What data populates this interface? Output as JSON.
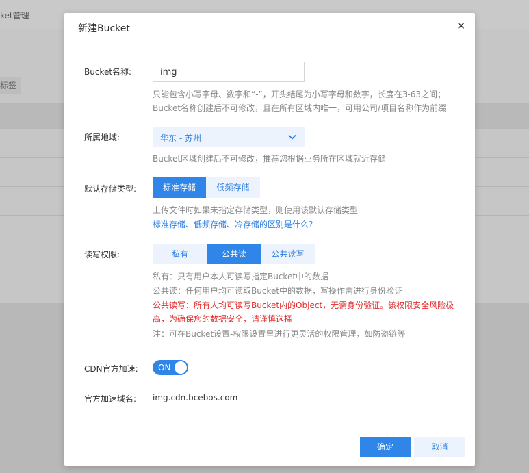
{
  "background": {
    "topbar_title": "ket管理",
    "tag_button": "标签"
  },
  "modal": {
    "title": "新建Bucket",
    "close_icon": "close-icon",
    "name": {
      "label": "Bucket名称:",
      "value": "img",
      "hint1": "只能包含小写字母、数字和“-”，开头结尾为小写字母和数字，长度在3-63之间；",
      "hint2": "Bucket名称创建后不可修改，且在所有区域内唯一，可用公司/项目名称作为前缀"
    },
    "region": {
      "label": "所属地域:",
      "value": "华东 - 苏州",
      "hint": "Bucket区域创建后不可修改，推荐您根据业务所在区域就近存储"
    },
    "storage": {
      "label": "默认存储类型:",
      "options": [
        "标准存储",
        "低频存储"
      ],
      "selected": "标准存储",
      "hint": "上传文件时如果未指定存储类型，则使用该默认存储类型",
      "link": "标准存储、低频存储、冷存储的区别是什么?"
    },
    "permission": {
      "label": "读写权限:",
      "options": [
        "私有",
        "公共读",
        "公共读写"
      ],
      "selected": "公共读",
      "desc_private": "私有：只有用户本人可读写指定Bucket中的数据",
      "desc_public_read": "公共读：任何用户均可读取Bucket中的数据，写操作需进行身份验证",
      "warn_line1": "公共读写：所有人均可读写Bucket内的Object，无需身份验证。该权限安全风险极",
      "warn_line2": "高，为确保您的数据安全，请谨慎选择",
      "note": "注：可在Bucket设置-权限设置里进行更灵活的权限管理，如防盗链等"
    },
    "cdn": {
      "label": "CDN官方加速:",
      "toggle_text": "ON",
      "enabled": true
    },
    "domain": {
      "label": "官方加速域名:",
      "value": "img.cdn.bcebos.com"
    },
    "buttons": {
      "confirm": "确定",
      "cancel": "取消"
    },
    "colors": {
      "primary": "#2f85e8",
      "light": "#ecf3fc",
      "warning": "#e02b2b"
    }
  }
}
